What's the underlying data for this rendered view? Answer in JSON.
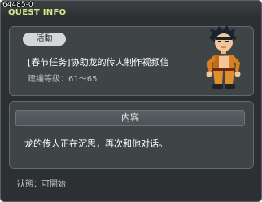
{
  "window": {
    "quest_id": "64485-0",
    "title": "QUEST INFO"
  },
  "quest": {
    "tag_label": "活動",
    "name": "[春节任务]协助龙的传人制作视频信",
    "level_requirement": "建議等級：61～65",
    "npc_icon": "npc-portrait-icon"
  },
  "content": {
    "header": "内容",
    "description": "龙的传人正在沉思，再次和他对话。"
  },
  "status": {
    "text": "狀態：可開始"
  },
  "colors": {
    "title": "#d6e88a",
    "window_bg": "#2c3032",
    "panel_bg": "#3f4547",
    "tag_bg": "#d3d7d8"
  }
}
